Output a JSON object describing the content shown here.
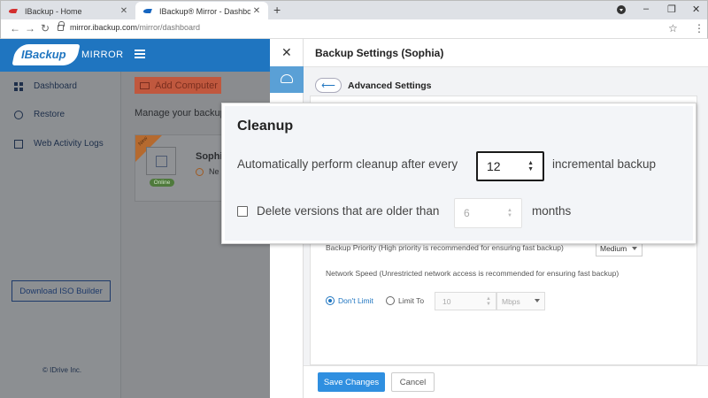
{
  "browser": {
    "tabs": [
      {
        "title": "IBackup - Home",
        "active": false
      },
      {
        "title": "IBackup® Mirror - Dashboard",
        "active": true
      }
    ],
    "new_tab": "+",
    "url_host": "mirror.ibackup.com",
    "url_path": "/mirror/dashboard",
    "window_controls": [
      "–",
      "❐",
      "✕"
    ]
  },
  "app": {
    "logo_text": "IBackup",
    "logo_suffix": "MIRROR",
    "sidebar": [
      {
        "label": "Dashboard",
        "icon": "dashboard-icon"
      },
      {
        "label": "Restore",
        "icon": "cloud-icon"
      },
      {
        "label": "Web Activity Logs",
        "icon": "logs-icon"
      }
    ],
    "download_iso": "Download ISO Builder",
    "copyright": "© IDrive Inc.",
    "add_computer": "Add Computer",
    "manage_text": "Manage your backup",
    "card": {
      "ribbon": "New",
      "name": "Sophi",
      "status": "Online",
      "sub": "Ne"
    }
  },
  "drawer": {
    "title": "Backup Settings (Sophia)",
    "back": "⟵",
    "advanced": "Advanced Settings",
    "backup_priority_text": "Backup Priority (High priority is recommended for ensuring fast backup)",
    "backup_priority_value": "Medium",
    "network_speed_text": "Network Speed (Unrestricted network access is recommended for ensuring fast backup)",
    "dont_limit": "Don't Limit",
    "limit_to": "Limit To",
    "limit_value": "10",
    "limit_unit": "Mbps",
    "save": "Save Changes",
    "cancel": "Cancel"
  },
  "cleanup": {
    "title": "Cleanup",
    "auto_text": "Automatically perform cleanup after every",
    "every_value": "12",
    "incremental_text": "incremental backup",
    "delete_text": "Delete versions that are older than",
    "months_value": "6",
    "months_text": "months"
  },
  "colors": {
    "brand_blue": "#1f75c0",
    "save_blue": "#2f8fe0",
    "add_red": "#c0583e"
  }
}
